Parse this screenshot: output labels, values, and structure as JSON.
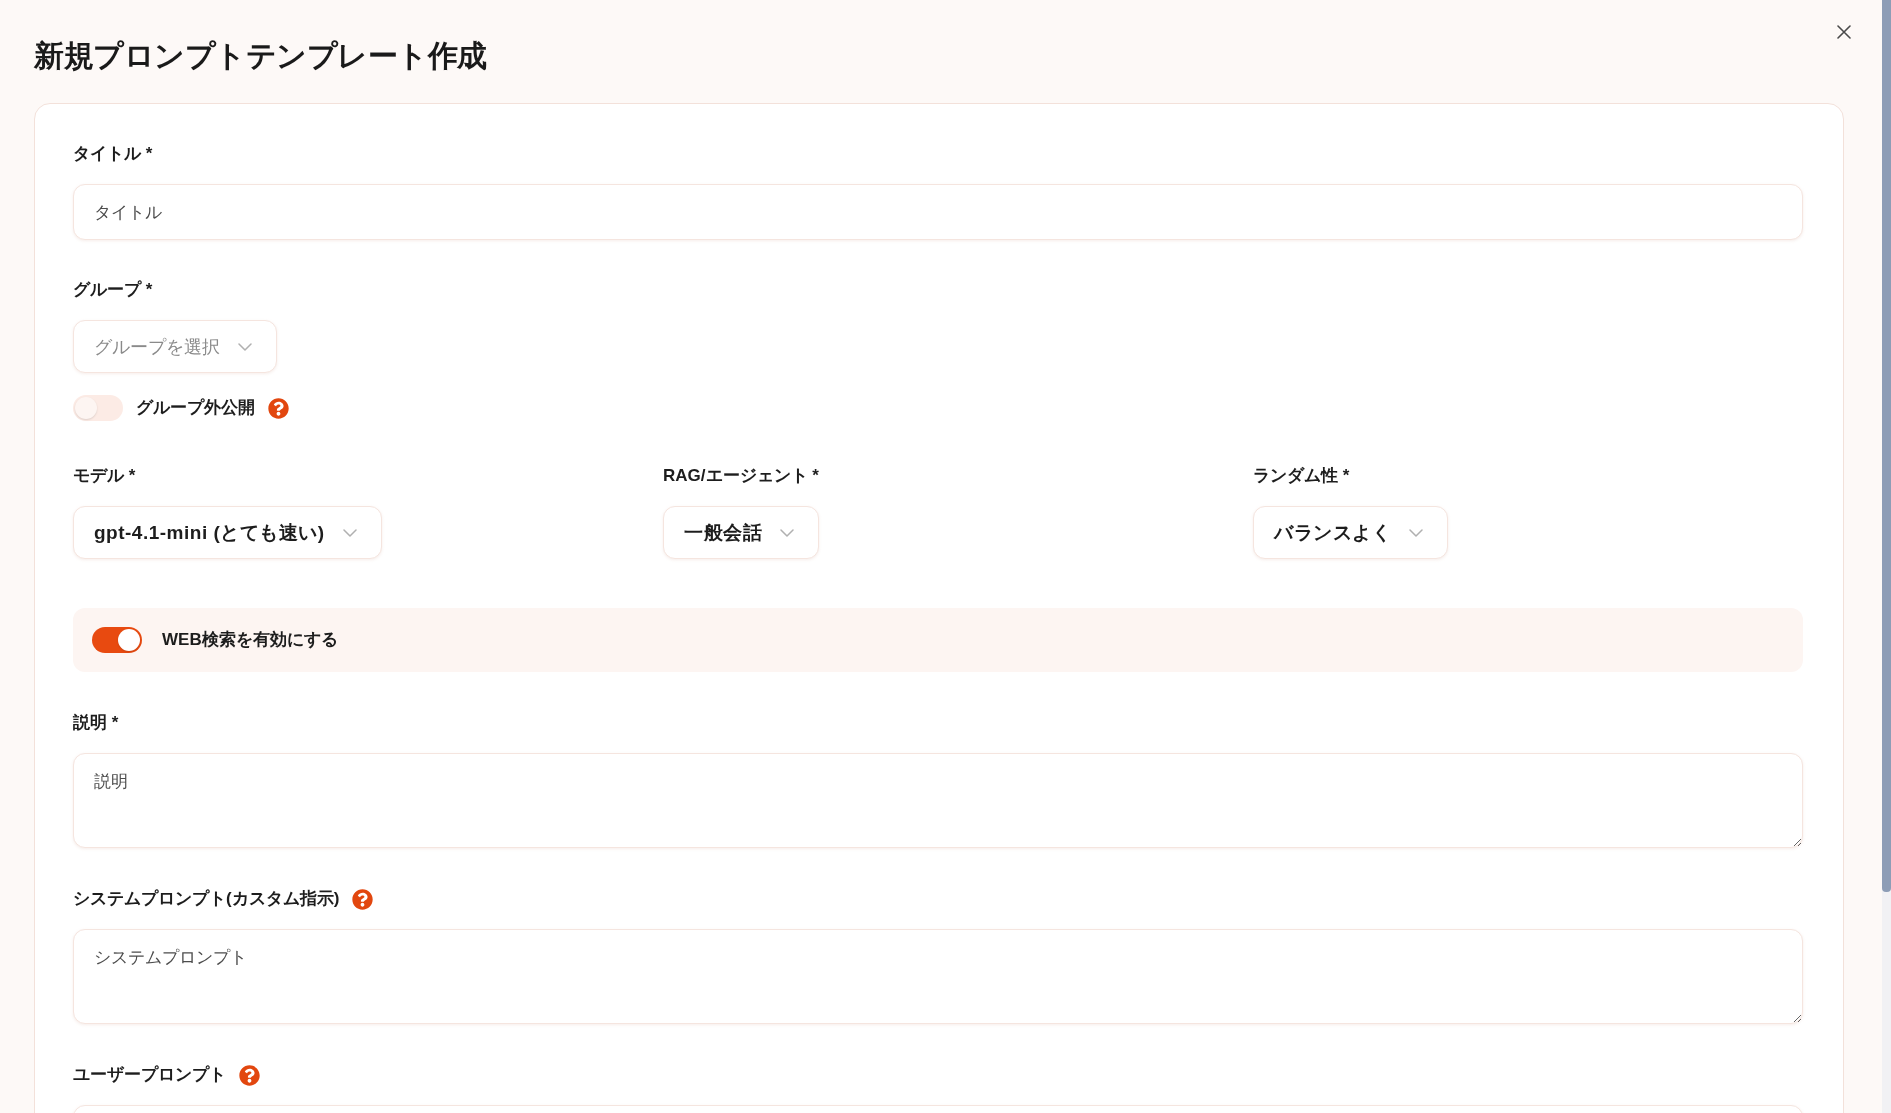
{
  "dialog": {
    "title": "新規プロンプトテンプレート作成"
  },
  "form": [
    {
      "kind": "text",
      "label": "タイトル *",
      "help": false,
      "placeholder": "タイトル"
    },
    {
      "kind": "select",
      "label": "グループ *",
      "help": false,
      "placeholder": "グループを選択"
    },
    {
      "kind": "switch",
      "label": "グループ外公開",
      "help": true,
      "on": false
    },
    {
      "kind": "select_row",
      "selects": [
        {
          "label": "モデル *",
          "value": "gpt-4.1-mini (とても速い)"
        },
        {
          "label": "RAG/エージェント *",
          "value": "一般会話"
        },
        {
          "label": "ランダム性 *",
          "value": "バランスよく"
        }
      ]
    },
    {
      "kind": "switch_panel",
      "label": "WEB検索を有効にする",
      "on": true
    },
    {
      "kind": "textarea",
      "label": "説明 *",
      "help": false,
      "placeholder": "説明"
    },
    {
      "kind": "textarea",
      "label": "システムプロンプト(カスタム指示)",
      "help": true,
      "placeholder": "システムプロンプト"
    },
    {
      "kind": "textarea",
      "label": "ユーザープロンプト",
      "help": true
    }
  ]
}
